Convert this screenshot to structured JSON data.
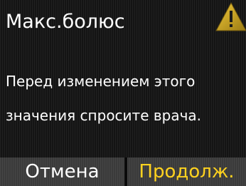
{
  "screen": {
    "title": "Макс.болюс",
    "warning_icon": "warning-triangle-icon",
    "message_lines": [
      "Перед изменением этого",
      "значения спросите врача."
    ]
  },
  "softkeys": {
    "left_label": "Отмена",
    "right_label": "Продолж."
  },
  "colors": {
    "background": "#141414",
    "text": "#ffffff",
    "accent": "#ffd21f",
    "softkey_bg": "#3a3a3a",
    "warning_fill": "#c8a019"
  }
}
